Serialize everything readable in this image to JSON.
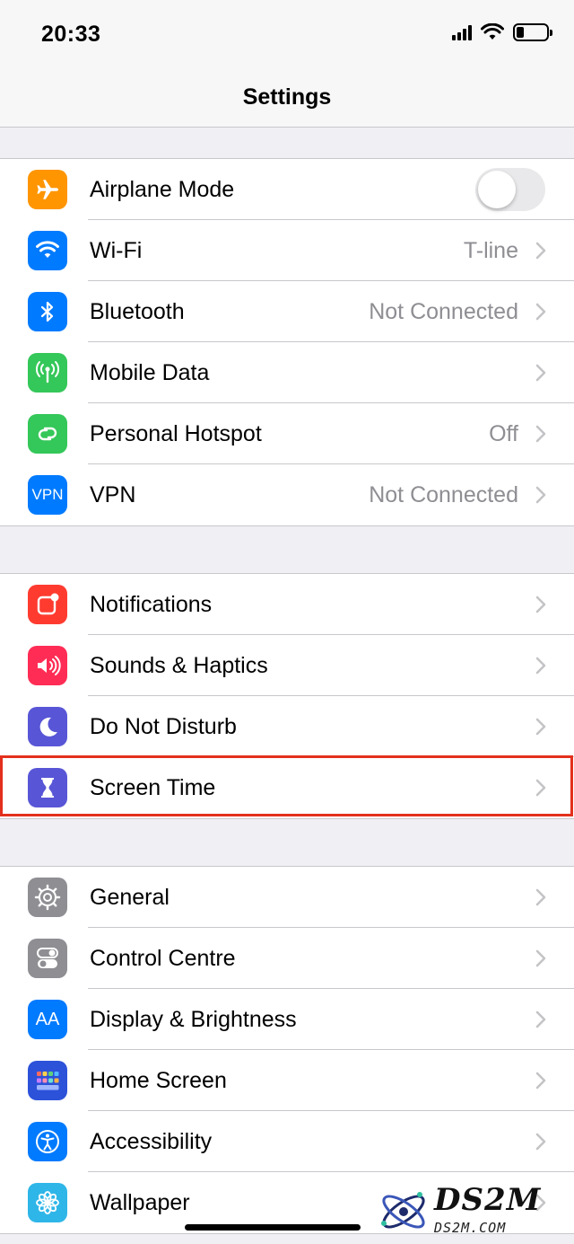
{
  "status_bar": {
    "time": "20:33"
  },
  "nav": {
    "title": "Settings"
  },
  "groups": [
    {
      "rows": [
        {
          "icon": "airplane-icon",
          "color": "#ff9500",
          "label": "Airplane Mode",
          "value": "",
          "control": "toggle",
          "toggle_on": false
        },
        {
          "icon": "wifi-icon",
          "color": "#007aff",
          "label": "Wi-Fi",
          "value": "T-line",
          "control": "chevron"
        },
        {
          "icon": "bluetooth-icon",
          "color": "#007aff",
          "label": "Bluetooth",
          "value": "Not Connected",
          "control": "chevron"
        },
        {
          "icon": "antenna-icon",
          "color": "#34c759",
          "label": "Mobile Data",
          "value": "",
          "control": "chevron"
        },
        {
          "icon": "hotspot-icon",
          "color": "#34c759",
          "label": "Personal Hotspot",
          "value": "Off",
          "control": "chevron"
        },
        {
          "icon": "vpn-icon",
          "color": "#007aff",
          "label": "VPN",
          "value": "Not Connected",
          "control": "chevron",
          "icon_text": "VPN"
        }
      ]
    },
    {
      "rows": [
        {
          "icon": "notifications-icon",
          "color": "#ff3b30",
          "label": "Notifications",
          "value": "",
          "control": "chevron"
        },
        {
          "icon": "speaker-icon",
          "color": "#ff2d55",
          "label": "Sounds & Haptics",
          "value": "",
          "control": "chevron"
        },
        {
          "icon": "moon-icon",
          "color": "#5856d6",
          "label": "Do Not Disturb",
          "value": "",
          "control": "chevron"
        },
        {
          "icon": "hourglass-icon",
          "color": "#5856d6",
          "label": "Screen Time",
          "value": "",
          "control": "chevron",
          "highlighted": true
        }
      ]
    },
    {
      "rows": [
        {
          "icon": "gear-icon",
          "color": "#8e8e93",
          "label": "General",
          "value": "",
          "control": "chevron"
        },
        {
          "icon": "switches-icon",
          "color": "#8e8e93",
          "label": "Control Centre",
          "value": "",
          "control": "chevron"
        },
        {
          "icon": "text-size-icon",
          "color": "#007aff",
          "label": "Display & Brightness",
          "value": "",
          "control": "chevron",
          "icon_text": "AA"
        },
        {
          "icon": "app-grid-icon",
          "color": "#2c52d9",
          "label": "Home Screen",
          "value": "",
          "control": "chevron"
        },
        {
          "icon": "accessibility-icon",
          "color": "#007aff",
          "label": "Accessibility",
          "value": "",
          "control": "chevron"
        },
        {
          "icon": "flower-icon",
          "color": "#2fb6e8",
          "label": "Wallpaper",
          "value": "",
          "control": "chevron"
        }
      ]
    }
  ],
  "highlight_color": "#e3301c",
  "watermark": {
    "text": "DS2M",
    "subtext": "DS2M.COM"
  }
}
